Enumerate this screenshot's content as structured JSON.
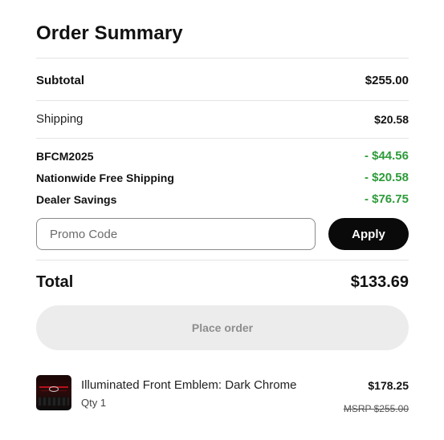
{
  "summary": {
    "title": "Order Summary",
    "subtotal": {
      "label": "Subtotal",
      "value": "$255.00"
    },
    "shipping": {
      "label": "Shipping",
      "value": "$20.58"
    },
    "discounts": [
      {
        "label": "BFCM2025",
        "value": "- $44.56"
      },
      {
        "label": "Nationwide Free Shipping",
        "value": "- $20.58"
      },
      {
        "label": "Dealer Savings",
        "value": "- $76.75"
      }
    ],
    "promo": {
      "placeholder": "Promo Code",
      "value": ""
    },
    "apply_label": "Apply",
    "total": {
      "label": "Total",
      "value": "$133.69"
    },
    "place_order_label": "Place order"
  },
  "items": [
    {
      "name": "Illuminated Front Emblem: Dark Chrome",
      "qty": "Qty 1",
      "price": "$178.25",
      "msrp": "MSRP $255.00"
    }
  ],
  "colors": {
    "discount": "#2e9b3a",
    "apply_bg": "#0a0a0a",
    "place_order_bg": "#ececec"
  }
}
